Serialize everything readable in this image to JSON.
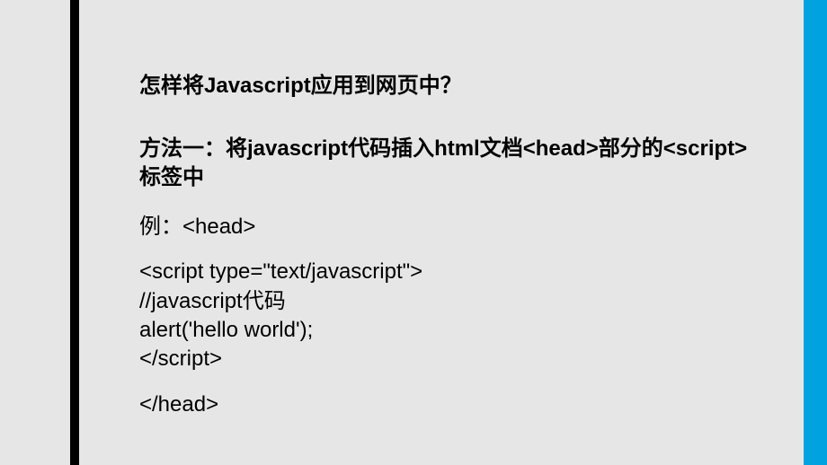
{
  "slide": {
    "title": "怎样将Javascript应用到网页中？",
    "subtitle": "方法一：将javascript代码插入html文档<head>部分的<script>标签中",
    "example_label": "例：<head>",
    "code": "<script type=\"text/javascript\">\n//javascript代码\nalert('hello world');\n</script>",
    "closing": "</head>"
  }
}
